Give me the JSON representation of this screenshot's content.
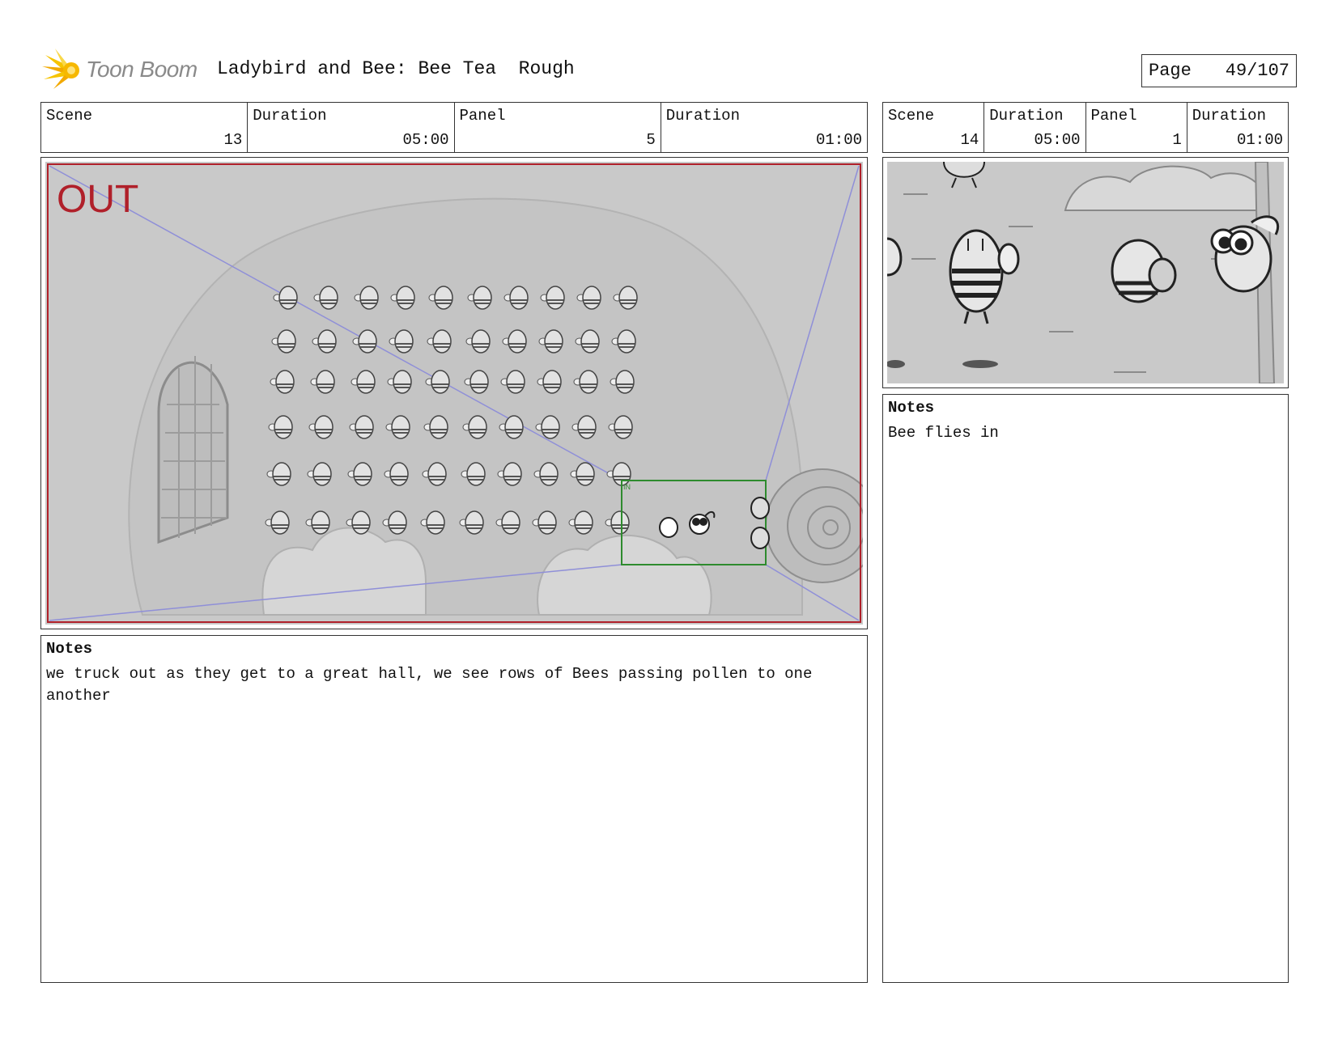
{
  "header": {
    "logo_text": "Toon Boom",
    "title": "Ladybird and Bee: Bee Tea  Rough",
    "page_label": "Page",
    "page_number": "49/107"
  },
  "panel_left": {
    "scene_label": "Scene",
    "scene_value": "13",
    "duration_label": "Duration",
    "duration_value": "05:00",
    "panel_label": "Panel",
    "panel_value": "5",
    "panel_duration_label": "Duration",
    "panel_duration_value": "01:00",
    "frame": {
      "out_label": "OUT",
      "in_label": "IN"
    },
    "notes_label": "Notes",
    "notes_text": "we truck out as they get to a great hall, we see rows of Bees passing pollen to one another"
  },
  "panel_right": {
    "scene_label": "Scene",
    "scene_value": "14",
    "duration_label": "Duration",
    "duration_value": "05:00",
    "panel_label": "Panel",
    "panel_value": "1",
    "panel_duration_label": "Duration",
    "panel_duration_value": "01:00",
    "notes_label": "Notes",
    "notes_text": "Bee flies in"
  },
  "colors": {
    "out_frame": "#b0202a",
    "in_frame": "#2e8b2e",
    "camera_lines": "#8f8fd8",
    "sketch_bg": "#c9c9c9"
  },
  "icons": {
    "logo": "sunburst-logo-icon"
  }
}
